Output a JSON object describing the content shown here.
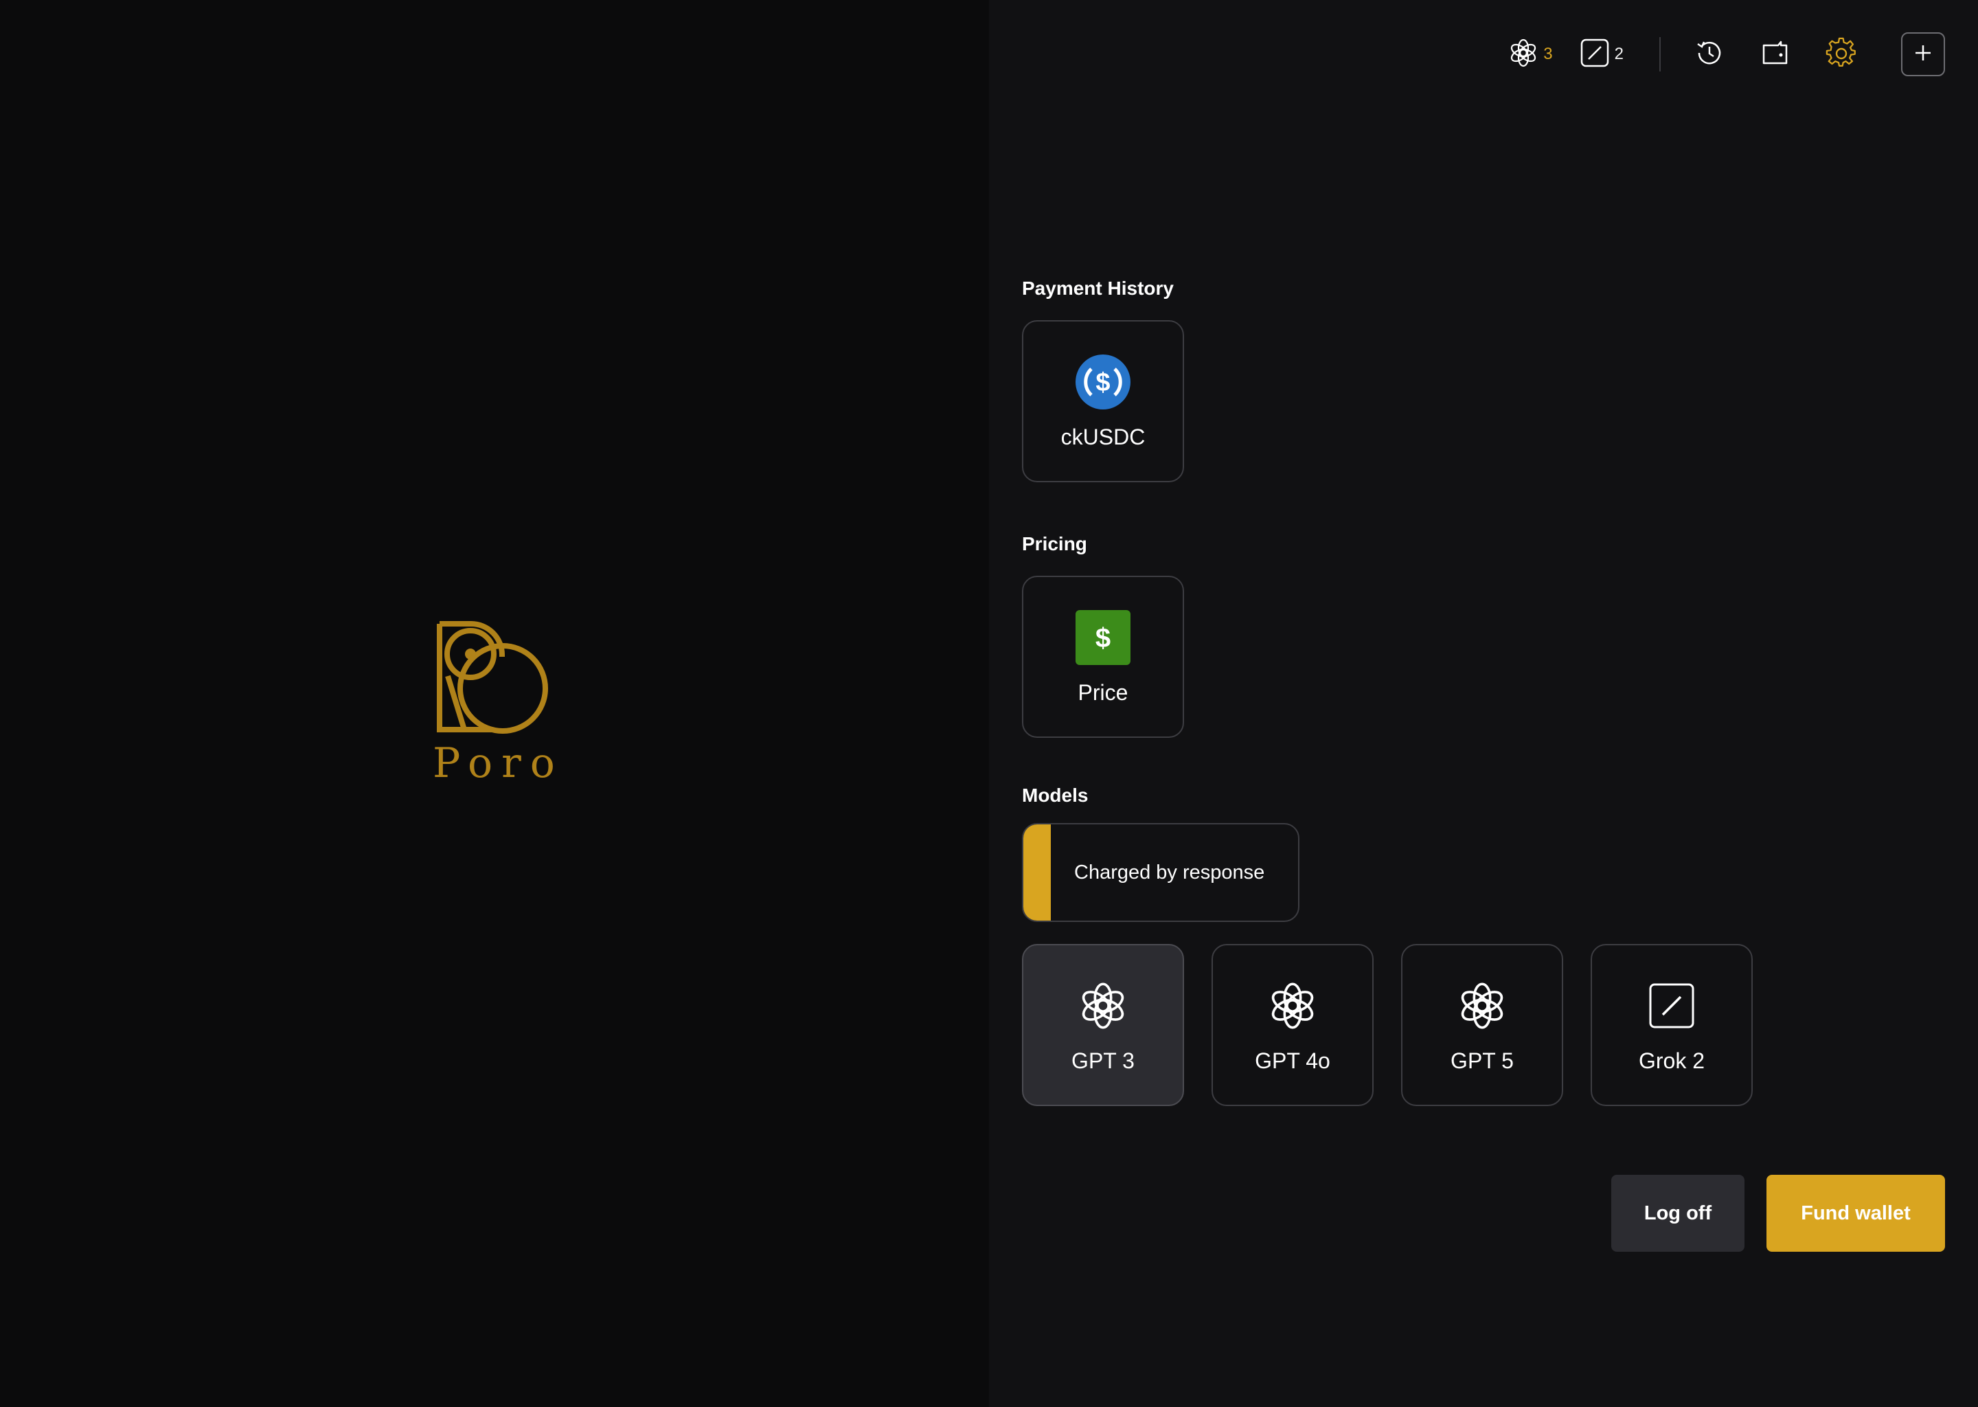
{
  "colors": {
    "accent": "#d9a520",
    "logo": "#b08219",
    "usdc_blue": "#2775ca",
    "price_green": "#3c8c1a"
  },
  "brand": {
    "name": "Poro",
    "icon": "poro-logo"
  },
  "topbar": {
    "credits": [
      {
        "icon": "openai-icon",
        "count": "3"
      },
      {
        "icon": "grok-icon",
        "count": "2"
      }
    ],
    "actions": [
      {
        "icon": "history-icon"
      },
      {
        "icon": "wallet-icon"
      },
      {
        "icon": "gear-icon"
      },
      {
        "icon": "plus-icon"
      }
    ]
  },
  "payment_history": {
    "title": "Payment History",
    "items": [
      {
        "label": "ckUSDC",
        "icon": "usdc-icon"
      }
    ]
  },
  "pricing": {
    "title": "Pricing",
    "items": [
      {
        "label": "Price",
        "icon": "dollar-icon"
      }
    ]
  },
  "models": {
    "title": "Models",
    "charge_mode": "Charged by response",
    "items": [
      {
        "label": "GPT 3",
        "icon": "openai-icon",
        "selected": true
      },
      {
        "label": "GPT 4o",
        "icon": "openai-icon",
        "selected": false
      },
      {
        "label": "GPT 5",
        "icon": "openai-icon",
        "selected": false
      },
      {
        "label": "Grok 2",
        "icon": "grok-icon",
        "selected": false
      }
    ]
  },
  "footer": {
    "logoff_label": "Log off",
    "fund_label": "Fund wallet"
  }
}
